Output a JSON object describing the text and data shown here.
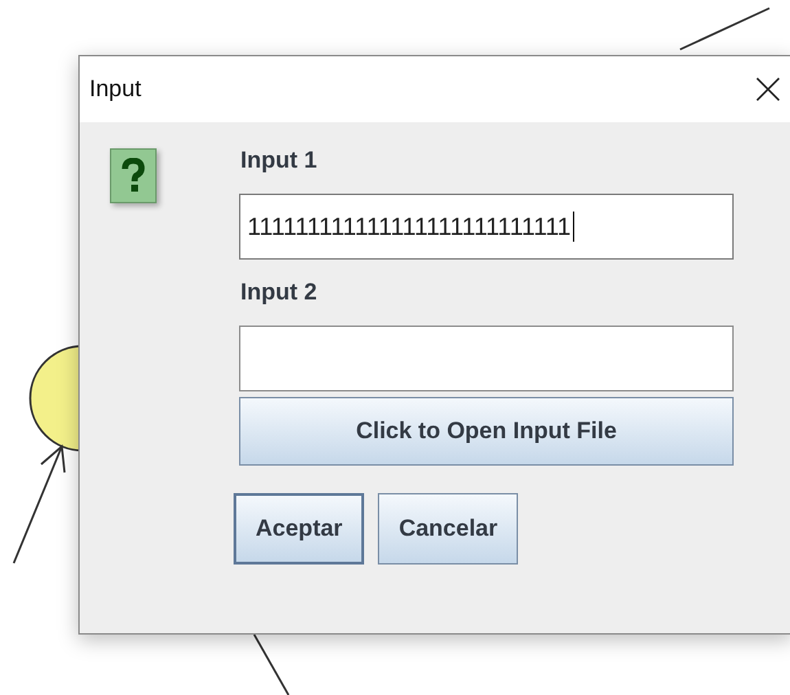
{
  "dialog": {
    "title": "Input"
  },
  "fields": [
    {
      "label": "Input 1",
      "value": "111111111111111111111111111",
      "focused": true
    },
    {
      "label": "Input 2",
      "focused": false
    }
  ],
  "file_button": {
    "label": "Click to Open Input File"
  },
  "buttons": [
    {
      "label": "Aceptar",
      "focused": true
    },
    {
      "label": "Cancelar",
      "focused": false
    }
  ]
}
